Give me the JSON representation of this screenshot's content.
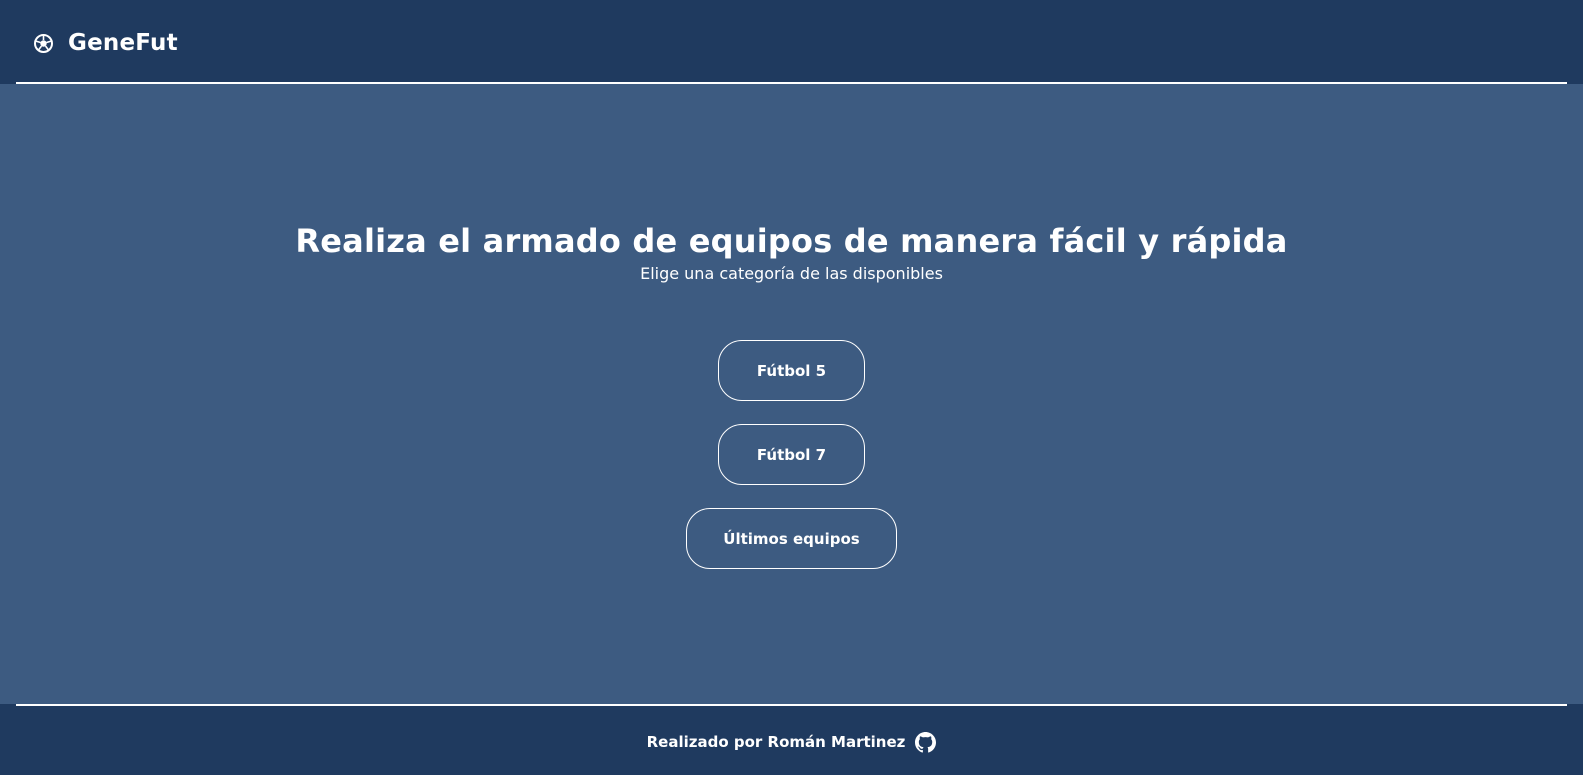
{
  "header": {
    "brand_name": "GeneFut",
    "brand_icon": "soccer-ball-icon"
  },
  "hero": {
    "title": "Realiza el armado de equipos de manera fácil y rápida",
    "subtitle": "Elige una categoría de las disponibles"
  },
  "categories": {
    "futbol5_label": "Fútbol 5",
    "futbol7_label": "Fútbol 7",
    "last_teams_label": "Últimos equipos"
  },
  "footer": {
    "credit_text": "Realizado por Román Martinez",
    "link_icon": "github-icon"
  },
  "colors": {
    "header_bg": "#1f3a5f",
    "page_bg": "#3d5b81",
    "text": "#ffffff"
  }
}
